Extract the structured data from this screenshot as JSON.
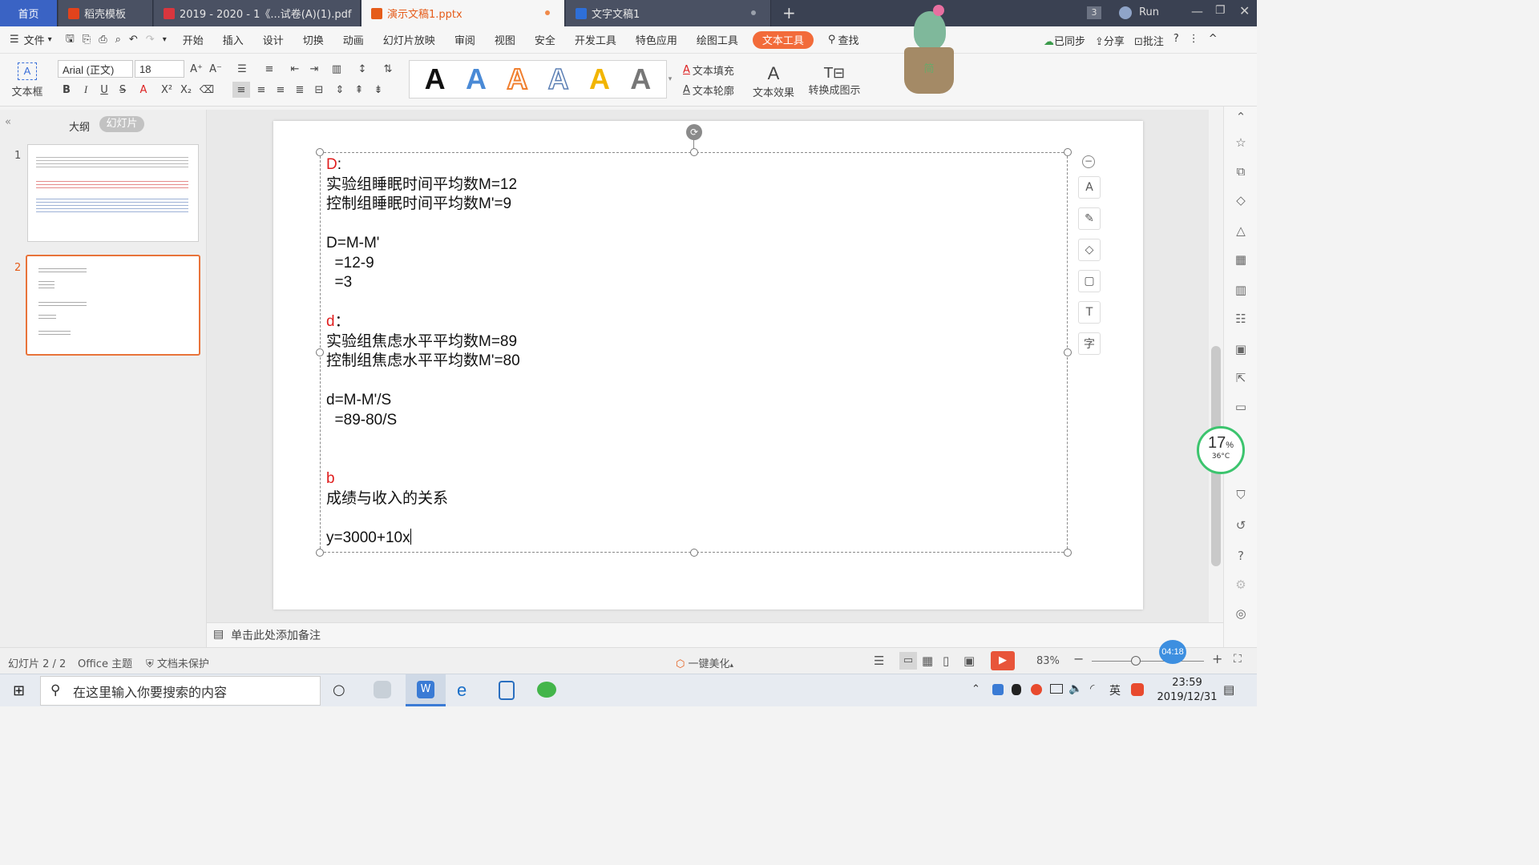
{
  "tabs": [
    {
      "label": "首页"
    },
    {
      "label": "稻壳模板"
    },
    {
      "label": "2019 - 2020 - 1《...试卷(A)(1).pdf"
    },
    {
      "label": "演示文稿1.pptx"
    },
    {
      "label": "文字文稿1"
    }
  ],
  "titlebar": {
    "badge": "3",
    "user": "Run"
  },
  "menu": {
    "file": "文件",
    "items": [
      "开始",
      "插入",
      "设计",
      "切换",
      "动画",
      "幻灯片放映",
      "审阅",
      "视图",
      "安全",
      "开发工具",
      "特色应用",
      "绘图工具",
      "文本工具"
    ],
    "search": "查找",
    "synced": "已同步",
    "share": "分享",
    "comment": "批注"
  },
  "toolbar": {
    "textbox": "文本框",
    "font": "Arial (正文)",
    "size": "18",
    "fill": "文本填充",
    "outline": "文本轮廓",
    "effect": "文本效果",
    "convert": "转换成图示",
    "style_glyph": "A"
  },
  "panel": {
    "outline_tab": "大纲",
    "slides_tab": "幻灯片",
    "slide_nums": [
      "1",
      "2"
    ]
  },
  "slide_text": {
    "l1": "D",
    "l1b": ":",
    "l2": "实验组睡眠时间平均数M=12",
    "l3": "控制组睡眠时间平均数M'=9",
    "l4": "D=M-M'",
    "l5": "  =12-9",
    "l6": "  =3",
    "l7": "d",
    "l7b": "：",
    "l8": "实验组焦虑水平平均数M=89",
    "l9": "控制组焦虑水平平均数M'=80",
    "l10": "d=M-M'/S",
    "l11": "  =89-80/S",
    "l12": "b",
    "l13": "成绩与收入的关系",
    "l14": "y=3000+10x"
  },
  "notes": {
    "placeholder": "单击此处添加备注"
  },
  "status": {
    "slide_info": "幻灯片 2 / 2",
    "theme": "Office 主题",
    "protect": "文档未保护",
    "beautify": "一键美化",
    "zoom": "83%",
    "timer": "04:18"
  },
  "widget": {
    "percent": "17",
    "temp": "36°C"
  },
  "taskbar": {
    "search": "在这里输入你要搜索的内容",
    "time": "23:59",
    "date": "2019/12/31",
    "ime": "英"
  },
  "plant": {
    "label": "简"
  },
  "colors": {
    "accent": "#e55c1a",
    "active_menu": "#f26b3a",
    "red_text": "#e01e1e"
  }
}
